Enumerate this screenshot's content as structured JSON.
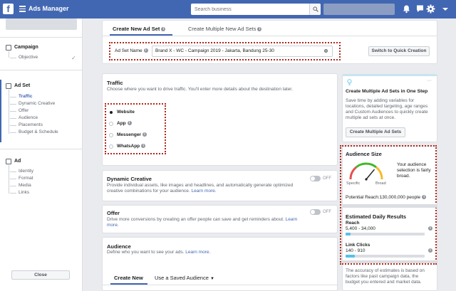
{
  "app": {
    "title": "Ads Manager",
    "logo": "f"
  },
  "search": {
    "placeholder": "Search business"
  },
  "sidebar": {
    "campaign": {
      "title": "Campaign",
      "items": [
        "Objective"
      ]
    },
    "adset": {
      "title": "Ad Set",
      "items": [
        "Traffic",
        "Dynamic Creative",
        "Offer",
        "Audience",
        "Placements",
        "Budget & Schedule"
      ]
    },
    "ad": {
      "title": "Ad",
      "items": [
        "Identity",
        "Format",
        "Media",
        "Links"
      ]
    },
    "close_label": "Close"
  },
  "tabs": {
    "create": "Create New Ad Set",
    "multiple": "Create Multiple New Ad Sets"
  },
  "adset_name": {
    "label": "Ad Set Name",
    "value": "Brand X - WC - Campaign 2019 - Jakarta, Bandung 25-30",
    "quick_btn": "Switch to Quick Creation"
  },
  "traffic": {
    "title": "Traffic",
    "desc": "Choose where you want to drive traffic. You'll enter more details about the destination later.",
    "options": [
      "Website",
      "App",
      "Messenger",
      "WhatsApp"
    ],
    "selected": "Website"
  },
  "dynamic_creative": {
    "title": "Dynamic Creative",
    "desc": "Provide individual assets, like images and headlines, and automatically generate optimized creative combinations for your audience.",
    "link": "Learn more.",
    "toggle": "OFF"
  },
  "offer": {
    "title": "Offer",
    "desc": "Drive more conversions by creating an offer people can save and get reminders about.",
    "link": "Learn more.",
    "toggle": "OFF"
  },
  "audience": {
    "title": "Audience",
    "desc": "Define who you want to see your ads.",
    "link": "Learn more.",
    "tab_new": "Create New",
    "tab_saved": "Use a Saved Audience"
  },
  "multi_card": {
    "title": "Create Multiple Ad Sets in One Step",
    "desc": "Save time by adding variables for locations, detailed targeting, age ranges and Custom Audiences to quickly create multiple ad sets at once.",
    "button": "Create Multiple Ad Sets",
    "more": "···"
  },
  "audience_size": {
    "title": "Audience Size",
    "status": "Your audience selection is fairly broad.",
    "specific": "Specific",
    "broad": "Broad",
    "reach": "Potential Reach:130,000,000 people",
    "gauge_level": 0.72
  },
  "estimates": {
    "title": "Estimated Daily Results",
    "reach_label": "Reach",
    "reach_value": "5,400 - 34,000",
    "reach_fill": 0.06,
    "clicks_label": "Link Clicks",
    "clicks_value": "140 - 910",
    "clicks_fill": 0.12,
    "footer": "The accuracy of estimates is based on factors like past campaign data, the budget you entered and market data."
  },
  "colors": {
    "brand": "#4267b2",
    "highlight": "#b0281e",
    "bar": "#57c1e8"
  }
}
